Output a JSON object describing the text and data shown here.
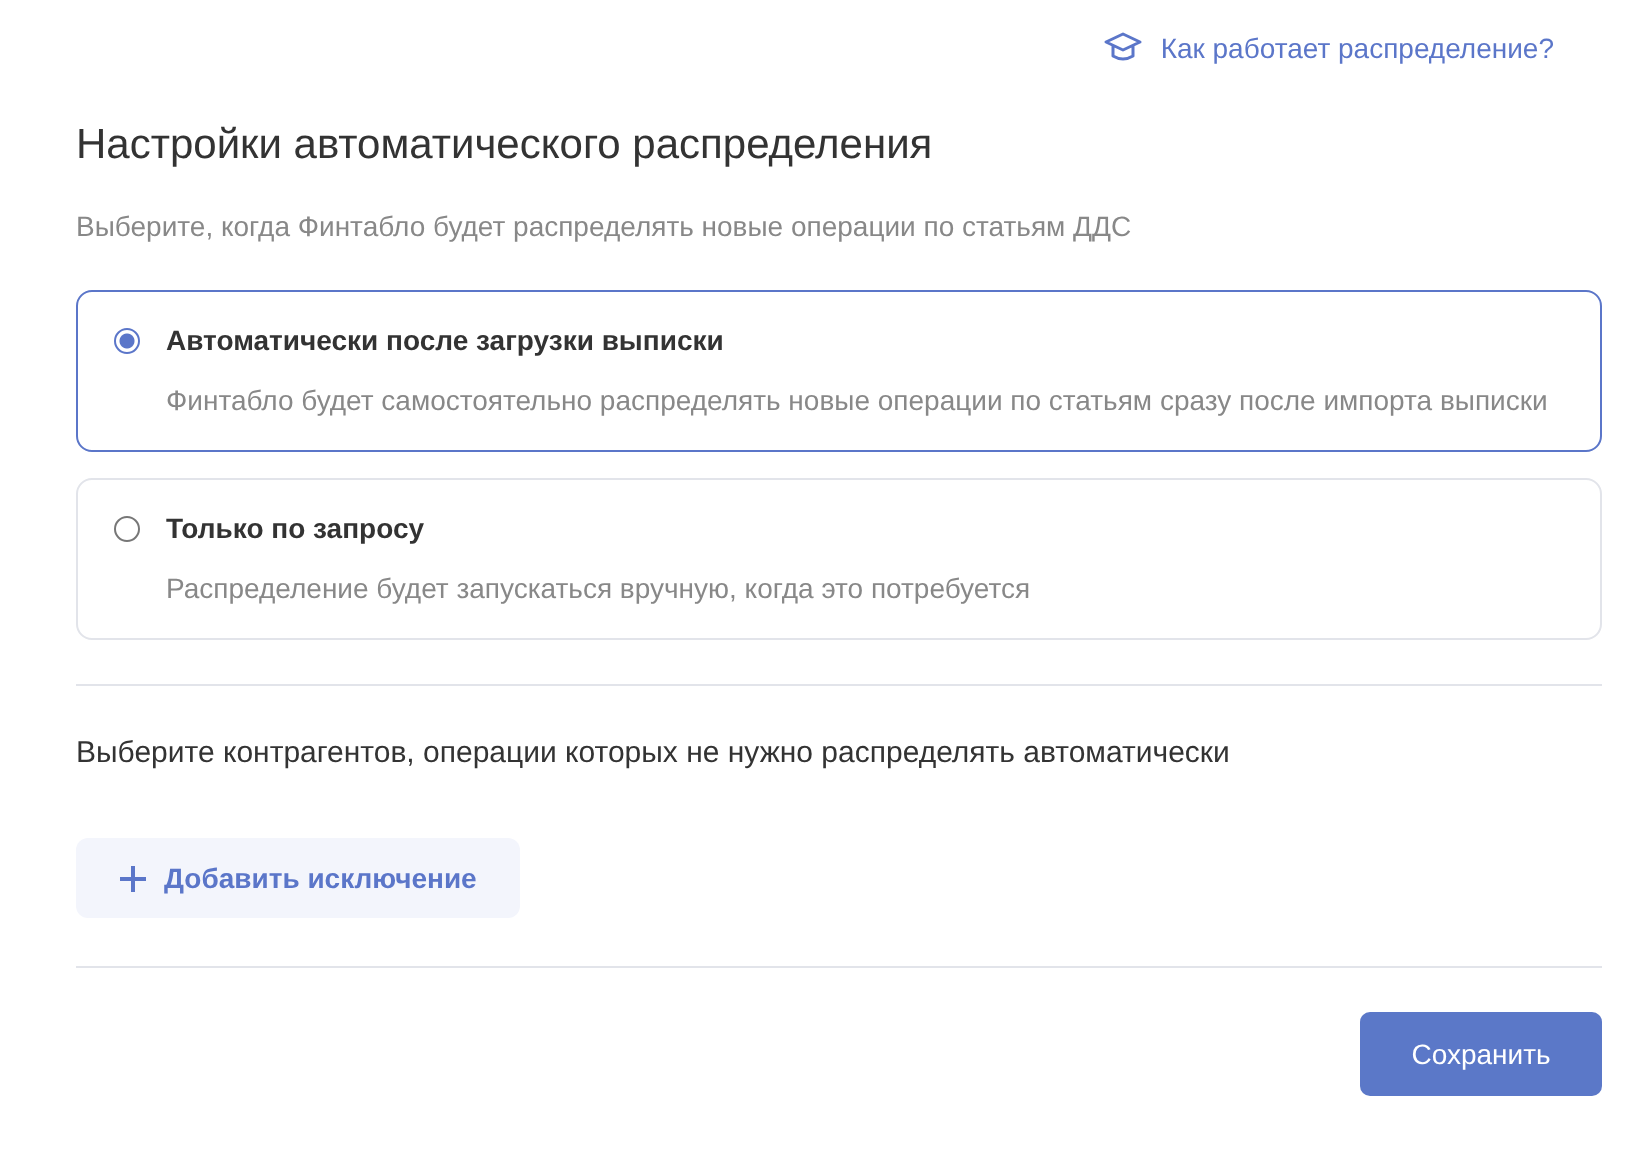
{
  "help_link": "Как работает распределение?",
  "title": "Настройки автоматического распределения",
  "subtitle": "Выберите, когда Финтабло будет распределять новые операции по статьям ДДС",
  "options": [
    {
      "label": "Автоматически после загрузки выписки",
      "description": "Финтабло будет самостоятельно распределять новые операции по статьям сразу после импорта выписки",
      "selected": true
    },
    {
      "label": "Только по запросу",
      "description": "Распределение будет запускаться вручную, когда это потребуется",
      "selected": false
    }
  ],
  "exclusions_label": "Выберите контрагентов, операции которых не нужно распределять автоматически",
  "add_button": "Добавить исключение",
  "save_button": "Сохранить"
}
